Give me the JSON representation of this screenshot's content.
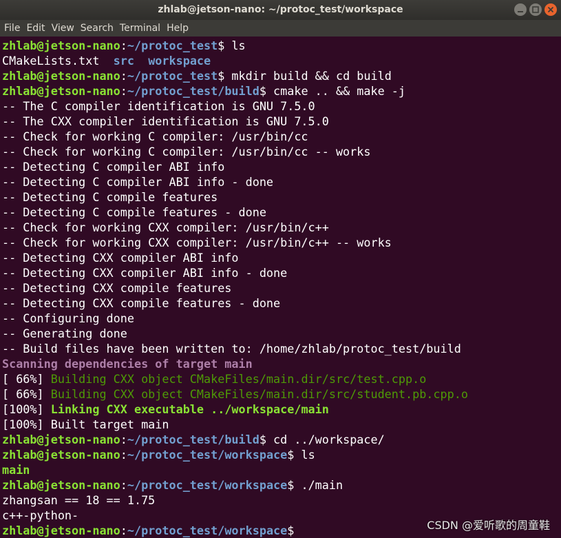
{
  "window": {
    "title": "zhlab@jetson-nano: ~/protoc_test/workspace"
  },
  "menu": [
    "File",
    "Edit",
    "View",
    "Search",
    "Terminal",
    "Help"
  ],
  "prompt": {
    "user_host": "zhlab@jetson-nano",
    "colon": ":",
    "dollar": "$"
  },
  "lines": [
    {
      "type": "prompt",
      "path": "~/protoc_test",
      "cmd": " ls"
    },
    {
      "type": "ls1",
      "a": "CMakeLists.txt",
      "b": "src",
      "c": "workspace"
    },
    {
      "type": "prompt",
      "path": "~/protoc_test",
      "cmd": " mkdir build && cd build"
    },
    {
      "type": "prompt",
      "path": "~/protoc_test/build",
      "cmd": " cmake .. && make -j"
    },
    {
      "type": "text",
      "text": "-- The C compiler identification is GNU 7.5.0"
    },
    {
      "type": "text",
      "text": "-- The CXX compiler identification is GNU 7.5.0"
    },
    {
      "type": "text",
      "text": "-- Check for working C compiler: /usr/bin/cc"
    },
    {
      "type": "text",
      "text": "-- Check for working C compiler: /usr/bin/cc -- works"
    },
    {
      "type": "text",
      "text": "-- Detecting C compiler ABI info"
    },
    {
      "type": "text",
      "text": "-- Detecting C compiler ABI info - done"
    },
    {
      "type": "text",
      "text": "-- Detecting C compile features"
    },
    {
      "type": "text",
      "text": "-- Detecting C compile features - done"
    },
    {
      "type": "text",
      "text": "-- Check for working CXX compiler: /usr/bin/c++"
    },
    {
      "type": "text",
      "text": "-- Check for working CXX compiler: /usr/bin/c++ -- works"
    },
    {
      "type": "text",
      "text": "-- Detecting CXX compiler ABI info"
    },
    {
      "type": "text",
      "text": "-- Detecting CXX compiler ABI info - done"
    },
    {
      "type": "text",
      "text": "-- Detecting CXX compile features"
    },
    {
      "type": "text",
      "text": "-- Detecting CXX compile features - done"
    },
    {
      "type": "text",
      "text": "-- Configuring done"
    },
    {
      "type": "text",
      "text": "-- Generating done"
    },
    {
      "type": "text",
      "text": "-- Build files have been written to: /home/zhlab/protoc_test/build"
    },
    {
      "type": "scan",
      "text": "Scanning dependencies of target main"
    },
    {
      "type": "build",
      "pct": "[ 66%] ",
      "text": "Building CXX object CMakeFiles/main.dir/src/test.cpp.o"
    },
    {
      "type": "build",
      "pct": "[ 66%] ",
      "text": "Building CXX object CMakeFiles/main.dir/src/student.pb.cpp.o"
    },
    {
      "type": "link",
      "pct": "[100%] ",
      "text": "Linking CXX executable ../workspace/main"
    },
    {
      "type": "text",
      "text": "[100%] Built target main"
    },
    {
      "type": "prompt",
      "path": "~/protoc_test/build",
      "cmd": " cd ../workspace/"
    },
    {
      "type": "prompt",
      "path": "~/protoc_test/workspace",
      "cmd": " ls"
    },
    {
      "type": "exe",
      "text": "main"
    },
    {
      "type": "prompt",
      "path": "~/protoc_test/workspace",
      "cmd": " ./main"
    },
    {
      "type": "text",
      "text": "zhangsan == 18 == 1.75"
    },
    {
      "type": "text",
      "text": "c++-python-"
    },
    {
      "type": "prompt",
      "path": "~/protoc_test/workspace",
      "cmd": ""
    }
  ],
  "watermark": "CSDN @爱听歌的周童鞋",
  "colors": {
    "background": "#300a24",
    "user_host": "#8ae234",
    "path": "#729fcf",
    "scan": "#ad7fa8",
    "build": "#4e9a06"
  }
}
